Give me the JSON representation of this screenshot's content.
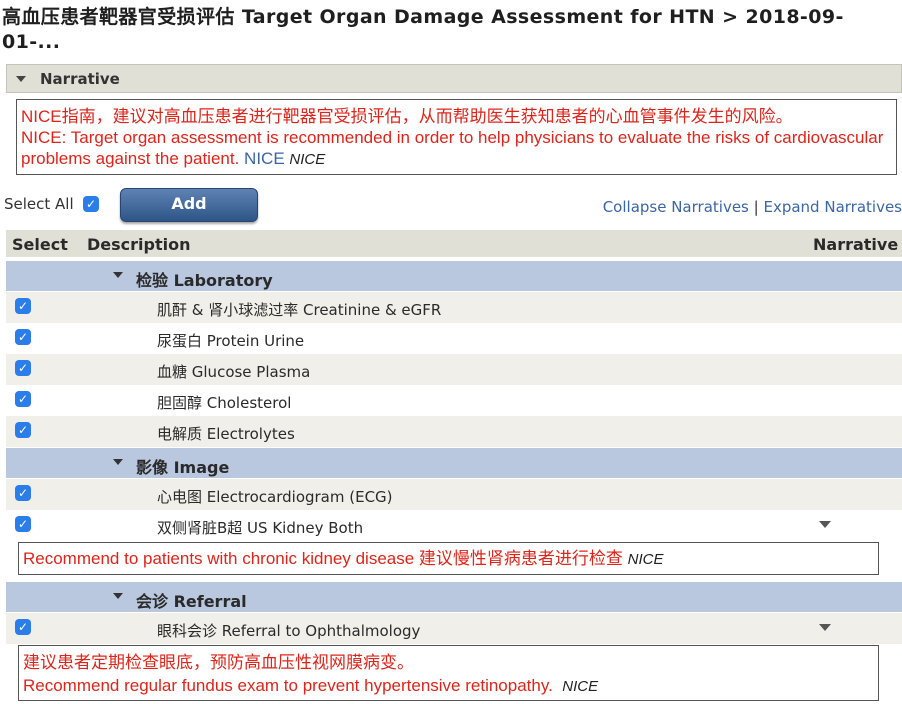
{
  "page": {
    "title": "高血压患者靶器官受损评估 Target Organ Damage Assessment for HTN > 2018-09-01-..."
  },
  "narrative_section": {
    "label": "Narrative",
    "text_cn": "NICE指南，建议对高血压患者进行靶器官受损评估，从而帮助医生获知患者的心血管事件发生的风险。",
    "text_en": "NICE: Target organ assessment is recommended in order to help physicians to evaluate the risks of cardiovascular problems against the patient.",
    "source_link": "NICE",
    "source_tag": "NICE"
  },
  "toolbar": {
    "select_all_label": "Select All",
    "add_label": "Add",
    "collapse_label": "Collapse Narratives",
    "separator": "|",
    "expand_label": "Expand Narratives"
  },
  "table": {
    "headers": {
      "select": "Select",
      "description": "Description",
      "narrative": "Narrative"
    }
  },
  "groups": [
    {
      "label": "检验 Laboratory",
      "items": [
        {
          "label": "肌酐 & 肾小球滤过率 Creatinine & eGFR",
          "checked": true
        },
        {
          "label": "尿蛋白 Protein Urine",
          "checked": true
        },
        {
          "label": "血糖 Glucose Plasma",
          "checked": true
        },
        {
          "label": "胆固醇 Cholesterol",
          "checked": true
        },
        {
          "label": "电解质 Electrolytes",
          "checked": true
        }
      ]
    },
    {
      "label": "影像 Image",
      "items": [
        {
          "label": "心电图 Electrocardiogram (ECG)",
          "checked": true
        },
        {
          "label": "双侧肾脏B超 US Kidney Both",
          "checked": true,
          "note": {
            "text": "Recommend to patients with chronic kidney disease 建议慢性肾病患者进行检查",
            "source": "NICE"
          }
        }
      ]
    },
    {
      "label": "会诊 Referral",
      "items": [
        {
          "label": "眼科会诊 Referral to Ophthalmology",
          "checked": true,
          "note": {
            "line1": "建议患者定期检查眼底，预防高血压性视网膜病变。",
            "line2": "Recommend regular fundus exam to prevent hypertensive retinopathy.",
            "source": "NICE"
          }
        }
      ]
    }
  ],
  "icons": {
    "check": "✓",
    "collapse_chevron": "chevron-down-icon",
    "narrative_toggle": "triangle-down-icon"
  },
  "colors": {
    "narrative_text": "#e0241a",
    "link": "#3a66a8",
    "group_bg": "#b9c8df",
    "header_bg": "#e1e0d6",
    "checkbox": "#2b7de9",
    "add_button": "#3e6496"
  }
}
